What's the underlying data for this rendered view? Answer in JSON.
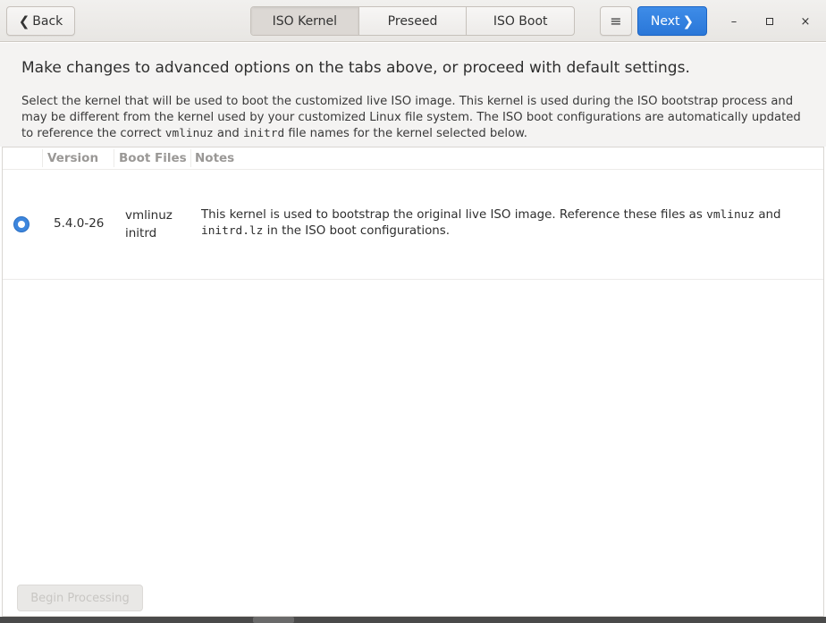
{
  "header": {
    "back_label": "Back",
    "tabs": [
      {
        "label": "ISO Kernel",
        "active": true
      },
      {
        "label": "Preseed",
        "active": false
      },
      {
        "label": "ISO Boot",
        "active": false
      }
    ],
    "menu_icon": "hamburger-icon",
    "next_label": "Next",
    "accent_color": "#2a77d8"
  },
  "window_controls": {
    "minimize": "–",
    "maximize_icon": "square-icon",
    "close": "×"
  },
  "intro": {
    "heading": "Make changes to advanced options on the tabs above, or proceed with default settings.",
    "desc_part1": "Select the kernel that will be used to boot the customized live ISO image. This kernel is used during the ISO bootstrap process and may be different from the kernel used by your customized Linux file system. The ISO boot configurations are automatically updated to reference the correct ",
    "desc_code1": "vmlinuz",
    "desc_part2": " and ",
    "desc_code2": "initrd",
    "desc_part3": " file names for the kernel selected below."
  },
  "table": {
    "columns": [
      "Version",
      "Boot Files",
      "Notes"
    ],
    "rows": [
      {
        "selected": true,
        "version": "5.4.0-26",
        "boot_files": [
          "vmlinuz",
          "initrd"
        ],
        "notes_part1": "This kernel is used to bootstrap the original live ISO image. Reference these files as ",
        "notes_code1": "vmlinuz",
        "notes_part2": " and ",
        "notes_code2": "initrd.lz",
        "notes_part3": " in the ISO boot configurations."
      }
    ]
  },
  "footer": {
    "disabled_button_label": "Begin Processing"
  }
}
